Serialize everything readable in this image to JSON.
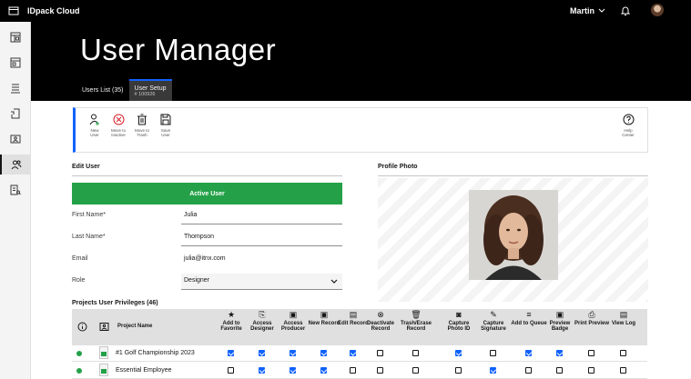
{
  "app": {
    "name": "IDpack Cloud",
    "user_name": "Martin"
  },
  "page": {
    "title": "User Manager"
  },
  "tabs": [
    {
      "label": "Users List (35)",
      "sub": ""
    },
    {
      "label": "User Setup",
      "sub": "# 100926"
    }
  ],
  "toolbar": {
    "new_user": "New\nUser",
    "move_inactive": "Move to\nInactive",
    "move_trash": "Move to\nTrash",
    "save_user": "Save\nUser",
    "help_center": "Help\nCenter"
  },
  "edit_user": {
    "heading": "Edit User",
    "status_label": "Active User",
    "fields": [
      {
        "label": "First Name*",
        "value": "Julia"
      },
      {
        "label": "Last Name*",
        "value": "Thompson"
      },
      {
        "label": "Email",
        "value": "julia@itnx.com"
      },
      {
        "label": "Role",
        "value": "Designer"
      }
    ]
  },
  "profile_photo": {
    "heading": "Profile Photo"
  },
  "privileges": {
    "heading": "Projects User Privileges (46)",
    "project_col": "Project Name",
    "columns": [
      "Add to Favorite",
      "Access Designer",
      "Access Producer",
      "New Record",
      "Edit Record",
      "Deactivate Record",
      "Trash/Erase Record",
      "Capture Photo ID",
      "Capture Signature",
      "Add to Queue",
      "Preview Badge",
      "Print Preview",
      "View Log"
    ],
    "rows": [
      {
        "name": "#1 Golf Championship 2023",
        "checks": [
          true,
          true,
          true,
          true,
          true,
          false,
          false,
          true,
          false,
          true,
          true,
          false,
          false
        ]
      },
      {
        "name": "Essential Employee",
        "checks": [
          false,
          true,
          true,
          true,
          false,
          false,
          false,
          false,
          true,
          false,
          false,
          false,
          false
        ]
      }
    ]
  },
  "colors": {
    "accent": "#0f62fe",
    "active_green": "#24a148",
    "header_bg": "#000000"
  }
}
